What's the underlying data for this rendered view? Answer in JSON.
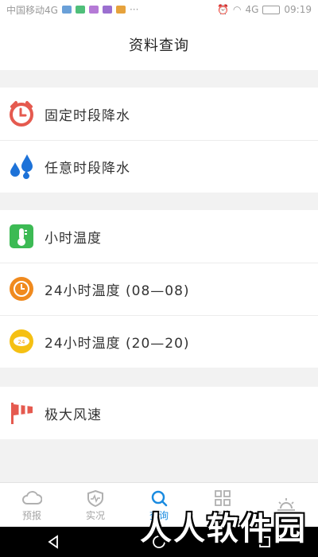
{
  "status_bar": {
    "carrier": "中国移动4G",
    "network": "4G",
    "time": "09:19",
    "more": "···"
  },
  "header": {
    "title": "资料查询"
  },
  "groups": [
    {
      "items": [
        {
          "label": "固定时段降水",
          "icon": "alarm-clock-icon"
        },
        {
          "label": "任意时段降水",
          "icon": "water-drops-icon"
        }
      ]
    },
    {
      "items": [
        {
          "label": "小时温度",
          "icon": "thermometer-icon"
        },
        {
          "label": "24小时温度 (08—08)",
          "icon": "orange-clock-icon"
        },
        {
          "label": "24小时温度 (20—20)",
          "icon": "yellow-temperature-icon"
        }
      ]
    },
    {
      "items": [
        {
          "label": "极大风速",
          "icon": "windsock-icon"
        }
      ]
    }
  ],
  "tabs": [
    {
      "label": "预报",
      "icon": "cloud-icon",
      "active": false
    },
    {
      "label": "实况",
      "icon": "shield-pulse-icon",
      "active": false
    },
    {
      "label": "查询",
      "icon": "search-icon",
      "active": true
    },
    {
      "label": "产品",
      "icon": "grid-icon",
      "active": false
    },
    {
      "label": "",
      "icon": "sunrise-icon",
      "active": false
    }
  ],
  "watermark": "人人软件园",
  "colors": {
    "accent": "#1a8be0",
    "red": "#e55a4f",
    "blue": "#1d72d8",
    "green": "#3cba54",
    "orange": "#f08a1e",
    "yellow": "#f5c013"
  }
}
